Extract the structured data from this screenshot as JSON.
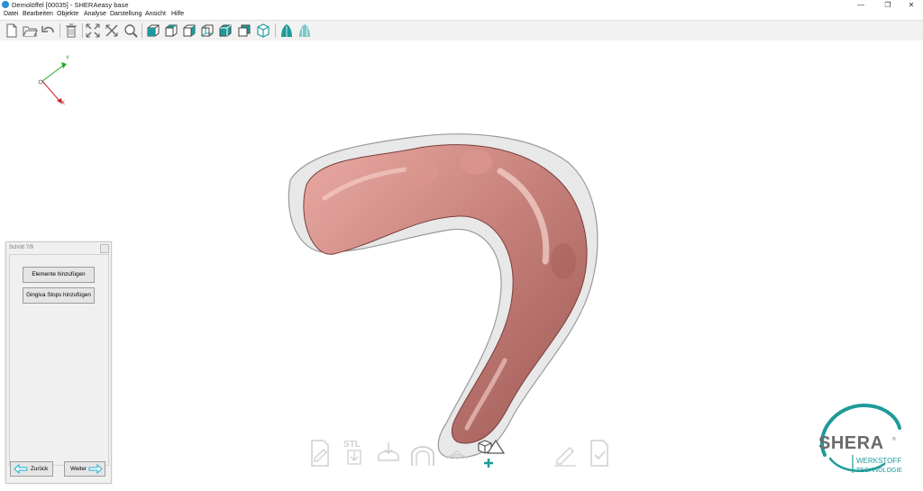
{
  "window": {
    "title": "Demolöffel [00035] - SHERAeasy base",
    "minimize": "—",
    "restore": "❐",
    "close": "✕"
  },
  "menu": [
    "Datei",
    "Bearbeiten",
    "Objekte",
    "Analyse",
    "Darstellung",
    "Ansicht",
    "Hilfe"
  ],
  "axis": {
    "y": "Y",
    "x": "X"
  },
  "wizard": {
    "title": "Schritt 7/9",
    "buttons": [
      "Elemente hinzufügen",
      "Gingiva Stops hinzufügen"
    ],
    "back_label": "Zurück",
    "next_label": "Weiter"
  },
  "steps": {
    "stl_label": "STL"
  },
  "logo": {
    "brand": "SHERA",
    "line1": "WERKSTOFF",
    "line2": "TECHNOLOGIE"
  },
  "colors": {
    "accent": "#1f9a9a",
    "model": "#c98a84",
    "arrow": "#1ab0d9"
  }
}
